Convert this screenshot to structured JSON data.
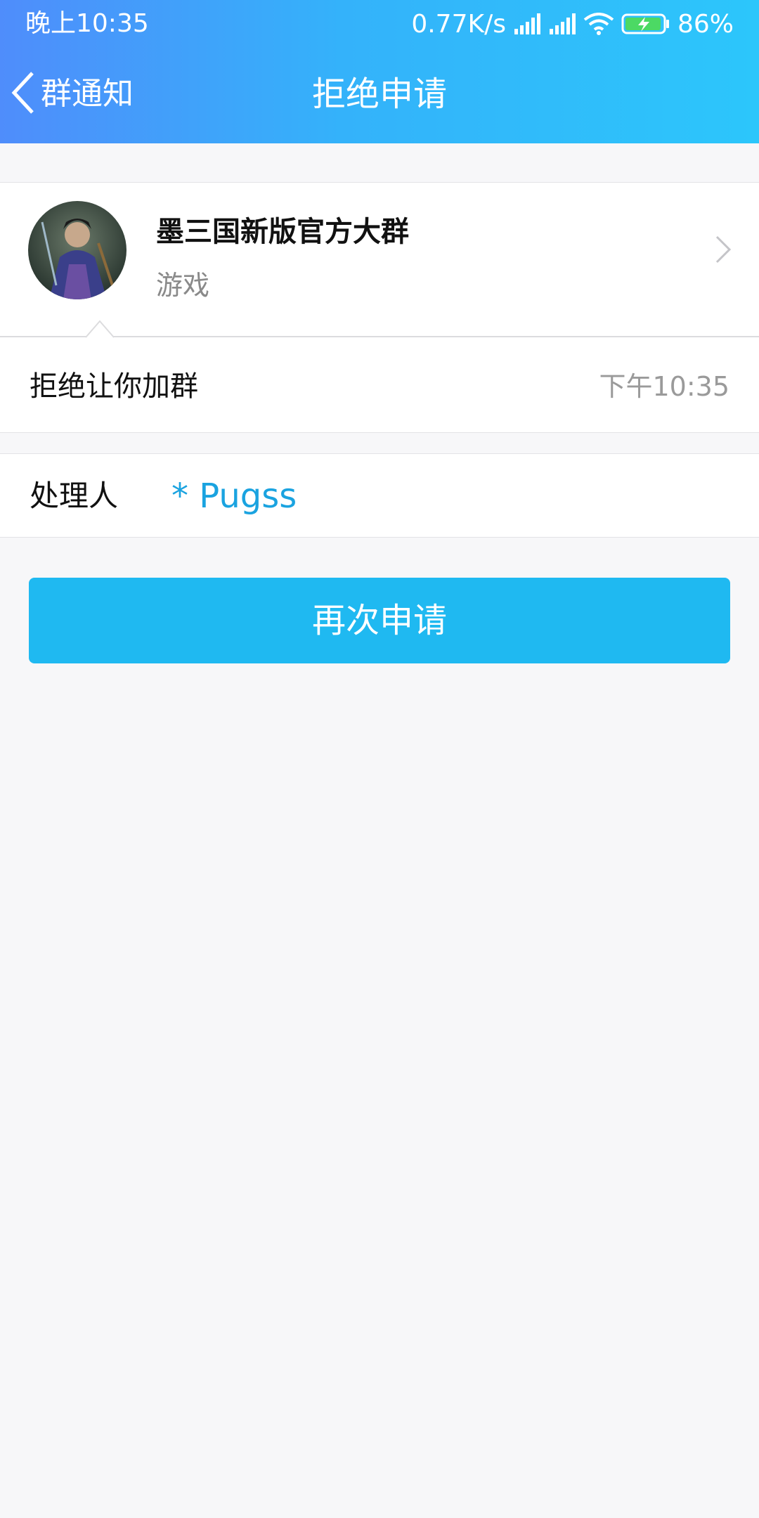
{
  "status_bar": {
    "time": "晚上10:35",
    "network_speed": "0.77K/s",
    "battery": "86%",
    "icons": [
      "signal-icon",
      "signal-icon",
      "wifi-icon",
      "battery-charging-icon"
    ]
  },
  "nav": {
    "back_label": "群通知",
    "title": "拒绝申请"
  },
  "group": {
    "name": "墨三国新版官方大群",
    "type": "游戏"
  },
  "reason": {
    "text": "拒绝让你加群",
    "time": "下午10:35"
  },
  "handler": {
    "label": "处理人",
    "value": "* Pugss"
  },
  "actions": {
    "reapply_label": "再次申请"
  },
  "colors": {
    "header_start": "#4f8dfb",
    "header_end": "#2cc6fb",
    "primary_button": "#1fb9f1",
    "link_text": "#1aa3e0"
  }
}
